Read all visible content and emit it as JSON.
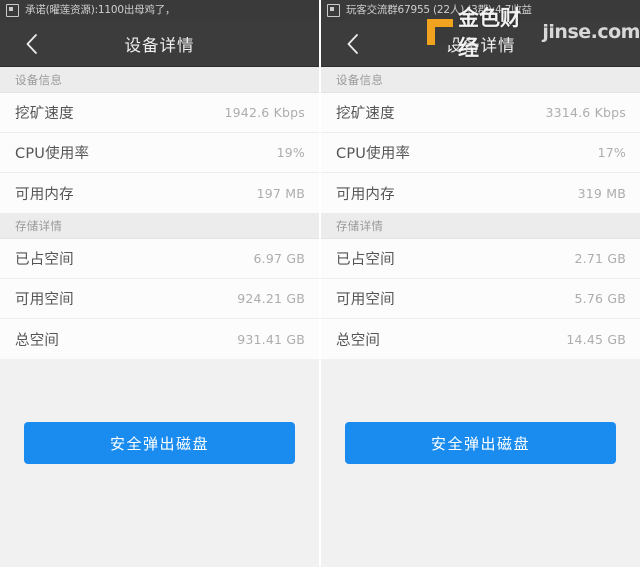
{
  "watermark": {
    "logo_name": "jinse-logo-icon",
    "cn_text": "金色财经",
    "en_text": "jinse.com"
  },
  "panels": [
    {
      "status_bar": {
        "icon": "notification-square-icon",
        "text": "承诺(曜莲资源):1100出母鸡了，"
      },
      "title_bar": {
        "back_icon": "chevron-left-icon",
        "title": "设备详情"
      },
      "sections": [
        {
          "header": "设备信息",
          "rows": [
            {
              "label": "挖矿速度",
              "value": "1942.6 Kbps"
            },
            {
              "label": "CPU使用率",
              "value": "19%"
            },
            {
              "label": "可用内存",
              "value": "197 MB"
            }
          ]
        },
        {
          "header": "存储详情",
          "rows": [
            {
              "label": "已占空间",
              "value": "6.97 GB"
            },
            {
              "label": "可用空间",
              "value": "924.21 GB"
            },
            {
              "label": "总空间",
              "value": "931.41 GB"
            }
          ]
        }
      ],
      "action_button": "安全弹出磁盘"
    },
    {
      "status_bar": {
        "icon": "notification-square-icon",
        "text": "玩客交流群67955 (22人) (3郡):4.7收益"
      },
      "title_bar": {
        "back_icon": "chevron-left-icon",
        "title": "设备详情"
      },
      "sections": [
        {
          "header": "设备信息",
          "rows": [
            {
              "label": "挖矿速度",
              "value": "3314.6 Kbps"
            },
            {
              "label": "CPU使用率",
              "value": "17%"
            },
            {
              "label": "可用内存",
              "value": "319 MB"
            }
          ]
        },
        {
          "header": "存储详情",
          "rows": [
            {
              "label": "已占空间",
              "value": "2.71 GB"
            },
            {
              "label": "可用空间",
              "value": "5.76 GB"
            },
            {
              "label": "总空间",
              "value": "14.45 GB"
            }
          ]
        }
      ],
      "action_button": "安全弹出磁盘"
    }
  ],
  "colors": {
    "status_bar_bg": "#3a3a3a",
    "title_bar_bg": "#3c3c3c",
    "page_bg": "#f1f1f1",
    "row_bg": "#fcfcfc",
    "button_blue": "#1a8cf0",
    "watermark_orange": "#f0a31e"
  }
}
